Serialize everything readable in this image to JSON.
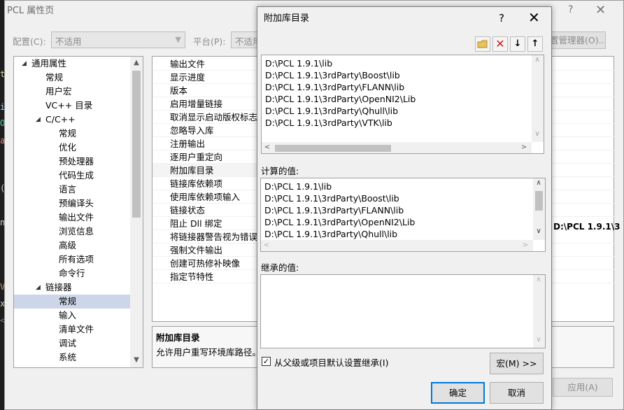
{
  "ide_strip": {
    "glyphs": [
      "t",
      "i",
      "O",
      "a",
      "(",
      "n",
      "V",
      "x",
      "<"
    ]
  },
  "property_page": {
    "title": "PCL 属性页",
    "help": "?",
    "close": "✕",
    "config_label": "配置(C):",
    "config_value": "不适用",
    "platform_label": "平台(P):",
    "platform_value": "不适用",
    "config_manager_button": "置管理器(O)...",
    "apply_button": "应用(A)",
    "tree": [
      {
        "label": "通用属性",
        "level": 0,
        "twisty": "◢"
      },
      {
        "label": "常规",
        "level": 1
      },
      {
        "label": "用户宏",
        "level": 1
      },
      {
        "label": "VC++ 目录",
        "level": 1
      },
      {
        "label": "C/C++",
        "level": 1,
        "twisty": "◢"
      },
      {
        "label": "常规",
        "level": 2
      },
      {
        "label": "优化",
        "level": 2
      },
      {
        "label": "预处理器",
        "level": 2
      },
      {
        "label": "代码生成",
        "level": 2
      },
      {
        "label": "语言",
        "level": 2
      },
      {
        "label": "预编译头",
        "level": 2
      },
      {
        "label": "输出文件",
        "level": 2
      },
      {
        "label": "浏览信息",
        "level": 2
      },
      {
        "label": "高级",
        "level": 2
      },
      {
        "label": "所有选项",
        "level": 2
      },
      {
        "label": "命令行",
        "level": 2
      },
      {
        "label": "链接器",
        "level": 1,
        "twisty": "◢"
      },
      {
        "label": "常规",
        "level": 2,
        "selected": true
      },
      {
        "label": "输入",
        "level": 2
      },
      {
        "label": "清单文件",
        "level": 2
      },
      {
        "label": "调试",
        "level": 2
      },
      {
        "label": "系统",
        "level": 2
      }
    ],
    "grid_rows": [
      "输出文件",
      "显示进度",
      "版本",
      "启用增量链接",
      "取消显示启动版权标志",
      "忽略导入库",
      "注册输出",
      "逐用户重定向",
      "附加库目录",
      "链接库依赖项",
      "使用库依赖项输入",
      "链接状态",
      "阻止 Dll 绑定",
      "将链接器警告视为错误",
      "强制文件输出",
      "创建可热修补映像",
      "指定节特性"
    ],
    "grid_right_value": "D:\\PCL 1.9.1\\3",
    "description": {
      "title": "附加库目录",
      "text": "允许用户重写环境库路径。"
    }
  },
  "modal": {
    "title": "附加库目录",
    "help": "?",
    "close": "✕",
    "toolbar": {
      "new_folder_icon": "new-folder",
      "delete_icon": "delete",
      "down_icon": "move-down",
      "up_icon": "move-up"
    },
    "edit_list": [
      "D:\\PCL 1.9.1\\lib",
      "D:\\PCL 1.9.1\\3rdParty\\Boost\\lib",
      "D:\\PCL 1.9.1\\3rdParty\\FLANN\\lib",
      "D:\\PCL 1.9.1\\3rdParty\\OpenNI2\\Lib",
      "D:\\PCL 1.9.1\\3rdParty\\Qhull\\lib",
      "D:\\PCL 1.9.1\\3rdParty\\VTK\\lib"
    ],
    "computed_label": "计算的值:",
    "computed_list": [
      "D:\\PCL 1.9.1\\lib",
      "D:\\PCL 1.9.1\\3rdParty\\Boost\\lib",
      "D:\\PCL 1.9.1\\3rdParty\\FLANN\\lib",
      "D:\\PCL 1.9.1\\3rdParty\\OpenNI2\\Lib",
      "D:\\PCL 1.9.1\\3rdParty\\Qhull\\lib"
    ],
    "inherited_label": "继承的值:",
    "inherit_checkbox": {
      "label": "从父级或项目默认设置继承(I)",
      "checked": true,
      "mark": "✓"
    },
    "macro_button": "宏(M) >>",
    "ok_button": "确定",
    "cancel_button": "取消"
  }
}
